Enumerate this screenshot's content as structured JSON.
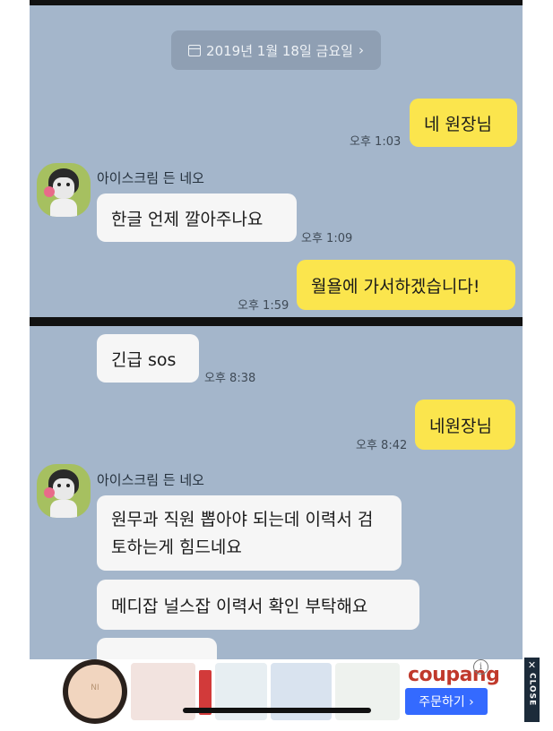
{
  "chat": {
    "date_label": "2019년 1월 18일 금요일",
    "sender_name": "아이스크림 든 네오",
    "messages": [
      {
        "side": "right",
        "text": "네 원장님",
        "time": "오후 1:03"
      },
      {
        "side": "left",
        "text": "한글 언제 깔아주나요",
        "time": "오후 1:09"
      },
      {
        "side": "right",
        "text": "월욜에 가서하겠습니다!",
        "time": "오후 1:59"
      },
      {
        "side": "left",
        "text": "긴급 sos",
        "time": "오후 8:38"
      },
      {
        "side": "right",
        "text": "네원장님",
        "time": "오후 8:42"
      },
      {
        "side": "left",
        "text": "원무과 직원 뽑아야 되는데 이력서 검토하는게  힘드네요",
        "time": ""
      },
      {
        "side": "left",
        "text": "메디잡 널스잡  이력서 확인 부탁해요",
        "time": ""
      }
    ]
  },
  "ad": {
    "brand": "coupang",
    "cta": "주문하기 ›",
    "info_symbol": "i",
    "close_x": "✕",
    "close_label": "CLOSE",
    "compact_logo": "NI"
  },
  "colors": {
    "chat_bg": "#a4b6cb",
    "my_bubble": "#fbe54d",
    "their_bubble": "#f6f6f6",
    "cta_blue": "#346aff"
  },
  "icons": [
    "calendar-icon",
    "chevron-right-icon",
    "info-icon",
    "close-icon"
  ]
}
